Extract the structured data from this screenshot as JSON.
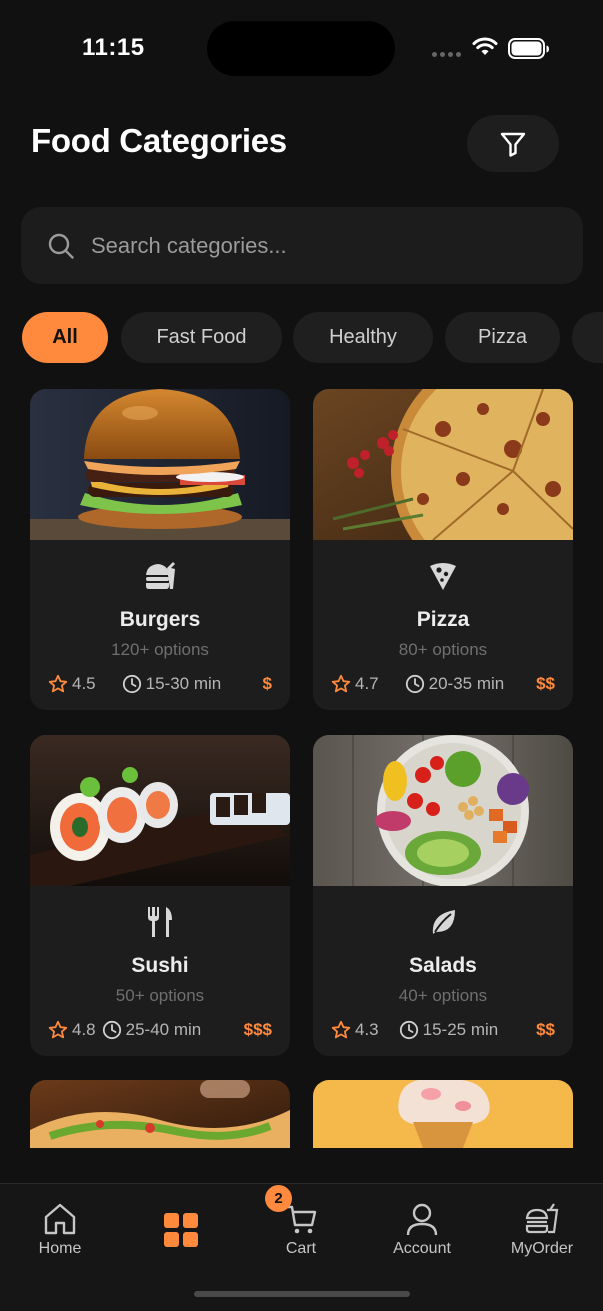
{
  "status": {
    "time": "11:15"
  },
  "header": {
    "title": "Food Categories"
  },
  "search": {
    "placeholder": "Search categories..."
  },
  "chips": [
    {
      "label": "All",
      "active": true
    },
    {
      "label": "Fast Food",
      "active": false
    },
    {
      "label": "Healthy",
      "active": false
    },
    {
      "label": "Pizza",
      "active": false
    }
  ],
  "categories": [
    {
      "name": "Burgers",
      "options": "120+ options",
      "rating": "4.5",
      "time": "15-30 min",
      "price": "$",
      "icon": "burger-icon"
    },
    {
      "name": "Pizza",
      "options": "80+ options",
      "rating": "4.7",
      "time": "20-35 min",
      "price": "$$",
      "icon": "pizza-slice-icon"
    },
    {
      "name": "Sushi",
      "options": "50+ options",
      "rating": "4.8",
      "time": "25-40 min",
      "price": "$$$",
      "icon": "fork-knife-icon"
    },
    {
      "name": "Salads",
      "options": "40+ options",
      "rating": "4.3",
      "time": "15-25 min",
      "price": "$$",
      "icon": "leaf-icon"
    }
  ],
  "nav": {
    "home": "Home",
    "categories": "",
    "cart": "Cart",
    "account": "Account",
    "orders": "MyOrder",
    "cart_badge": "2"
  },
  "colors": {
    "accent": "#ff8a3d",
    "background": "#111111",
    "card": "#1d1d1d"
  }
}
